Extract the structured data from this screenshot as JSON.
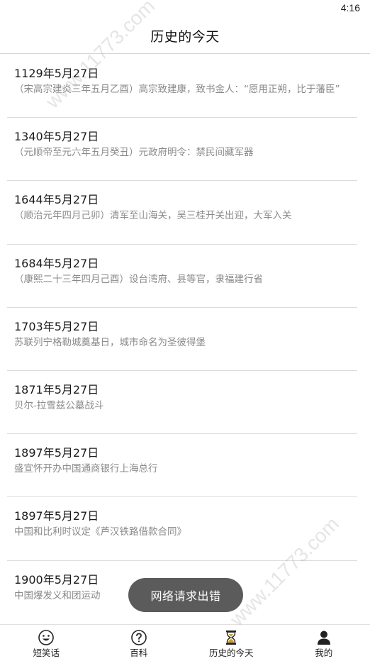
{
  "status_bar": {
    "time": "4:16"
  },
  "header": {
    "title": "历史的今天"
  },
  "events": [
    {
      "date": "1129年5月27日",
      "desc": "（宋高宗建炎三年五月乙酉）高宗致建康，致书金人：“愿用正朔，比于藩臣”"
    },
    {
      "date": "1340年5月27日",
      "desc": "（元顺帝至元六年五月癸丑）元政府明令：禁民间藏军器"
    },
    {
      "date": "1644年5月27日",
      "desc": "（顺治元年四月己卯）清军至山海关，吴三桂开关出迎，大军入关"
    },
    {
      "date": "1684年5月27日",
      "desc": "（康熙二十三年四月己酉）设台湾府、县等官，隶福建行省"
    },
    {
      "date": "1703年5月27日",
      "desc": "苏联列宁格勒城奠基日，城市命名为圣彼得堡"
    },
    {
      "date": "1871年5月27日",
      "desc": "贝尔-拉雪兹公墓战斗"
    },
    {
      "date": "1897年5月27日",
      "desc": "盛宣怀开办中国通商银行上海总行"
    },
    {
      "date": "1897年5月27日",
      "desc": "中国和比利时议定《芦汉铁路借款合同》"
    },
    {
      "date": "1900年5月27日",
      "desc": "中国爆发义和团运动"
    }
  ],
  "toast": {
    "message": "网络请求出错"
  },
  "bottom_nav": [
    {
      "label": "短笑话",
      "icon": "smiley-face-icon"
    },
    {
      "label": "百科",
      "icon": "question-circle-icon"
    },
    {
      "label": "历史的今天",
      "icon": "hourglass-icon",
      "active": true
    },
    {
      "label": "我的",
      "icon": "person-icon"
    }
  ],
  "watermark": "www.11773.com"
}
